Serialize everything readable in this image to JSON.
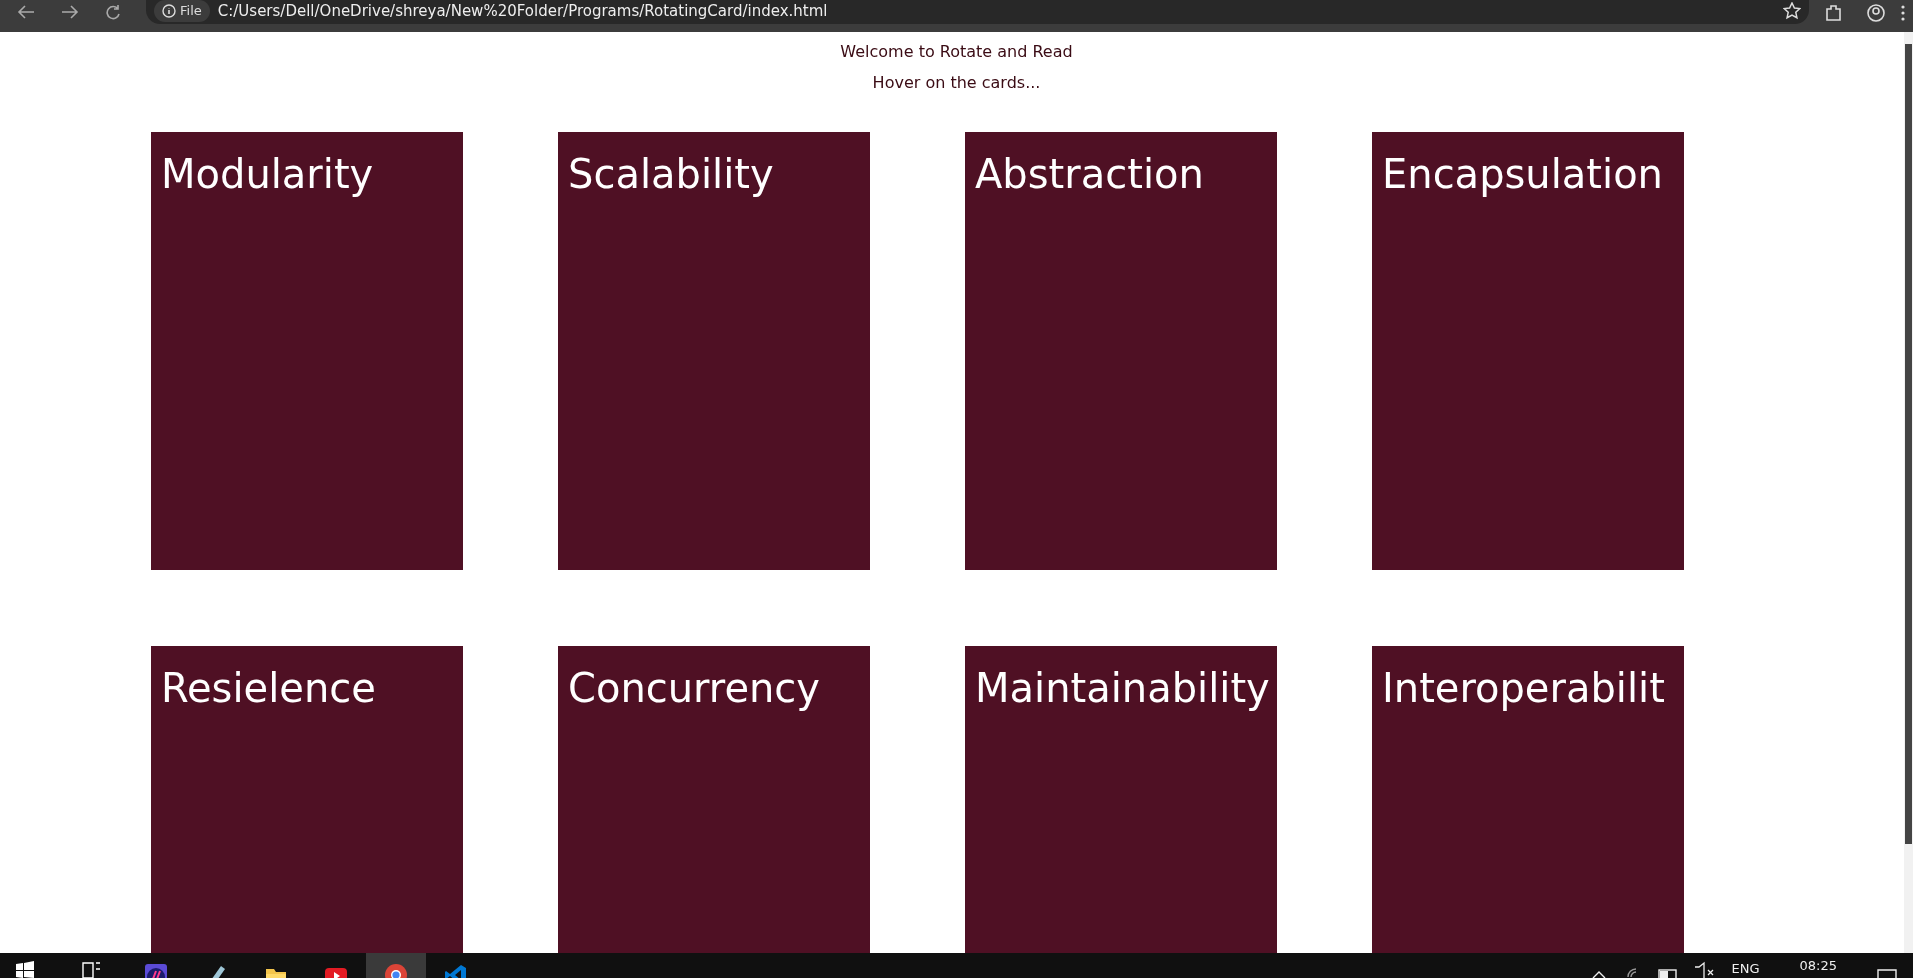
{
  "browser": {
    "chip": "File",
    "url": "C:/Users/Dell/OneDrive/shreya/New%20Folder/Programs/RotatingCard/index.html"
  },
  "page": {
    "lines": [
      "Welcome to Rotate and Read",
      "Hover on the cards..."
    ],
    "cards": [
      {
        "title": "Modularity"
      },
      {
        "title": "Scalability"
      },
      {
        "title": "Abstraction"
      },
      {
        "title": "Encapsulation"
      },
      {
        "title": "Resielence"
      },
      {
        "title": "Concurrency"
      },
      {
        "title": "Maintainability"
      },
      {
        "title": "Interoperabilit"
      }
    ]
  },
  "taskbar": {
    "apps": [
      {
        "kind": "purple",
        "selected": false
      },
      {
        "kind": "pen",
        "selected": false
      },
      {
        "kind": "folder",
        "selected": false
      },
      {
        "kind": "play",
        "selected": false
      },
      {
        "kind": "chrome",
        "selected": true
      },
      {
        "kind": "code",
        "selected": false
      }
    ],
    "language": "ENG",
    "clock": "08:25"
  }
}
